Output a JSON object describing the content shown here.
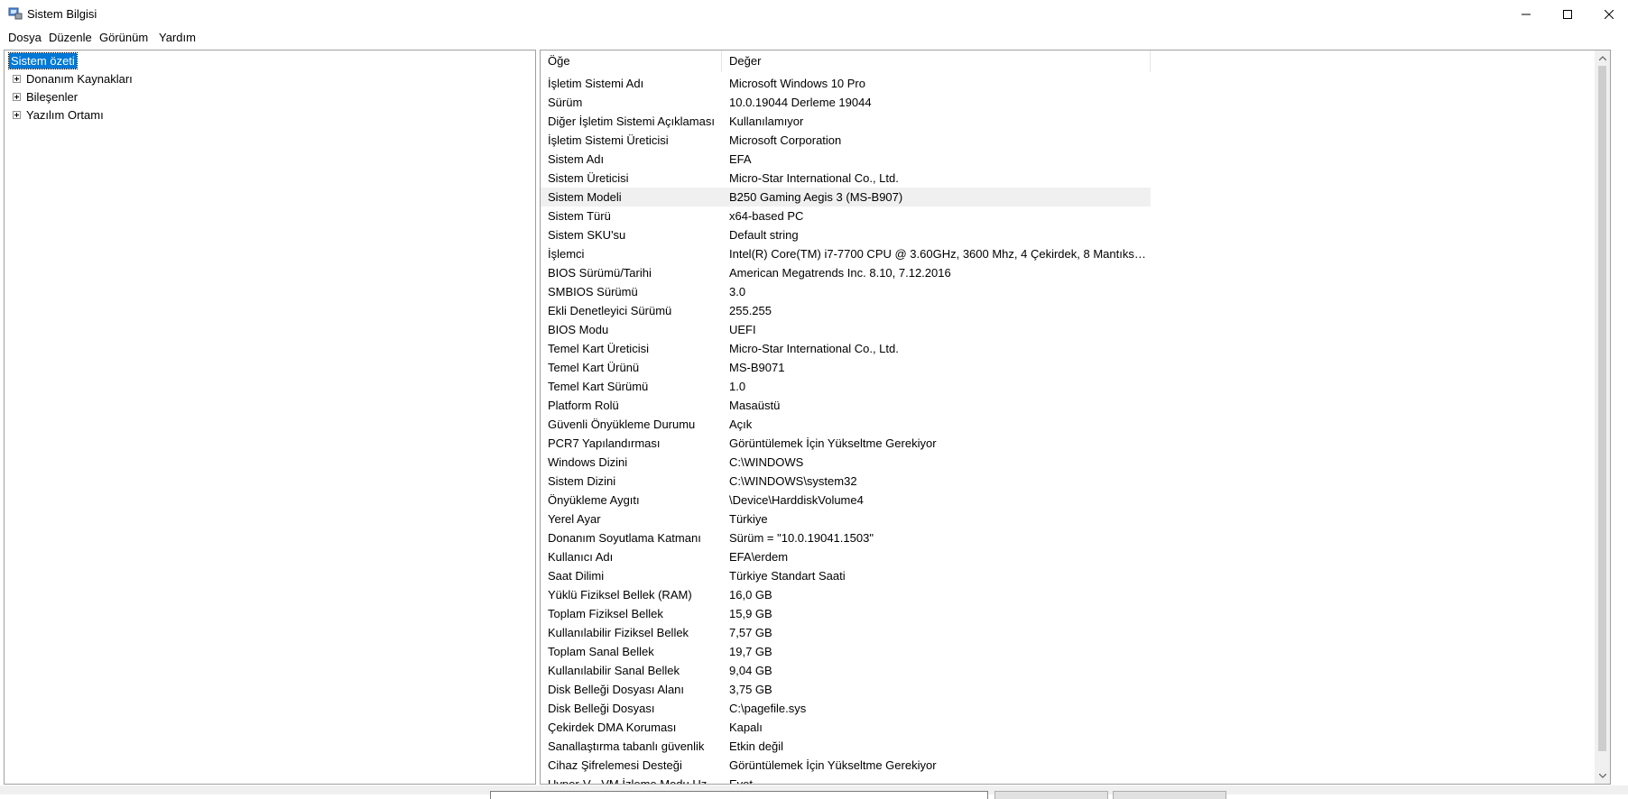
{
  "window": {
    "title": "Sistem Bilgisi",
    "controls": {
      "minimize": "minimize-icon",
      "maximize": "maximize-icon",
      "close": "close-icon"
    }
  },
  "menu": [
    "Dosya",
    "Düzenle",
    "Görünüm",
    "Yardım"
  ],
  "tree": {
    "selected": "Sistem özeti",
    "children": [
      "Donanım Kaynakları",
      "Bileşenler",
      "Yazılım Ortamı"
    ]
  },
  "table": {
    "headers": [
      "Öğe",
      "Değer"
    ],
    "highlight_row": 6,
    "rows": [
      [
        "İşletim Sistemi Adı",
        "Microsoft Windows 10 Pro"
      ],
      [
        "Sürüm",
        "10.0.19044 Derleme 19044"
      ],
      [
        "Diğer İşletim Sistemi Açıklaması",
        "Kullanılamıyor"
      ],
      [
        "İşletim Sistemi Üreticisi",
        "Microsoft Corporation"
      ],
      [
        "Sistem Adı",
        "EFA"
      ],
      [
        "Sistem Üreticisi",
        "Micro-Star International Co., Ltd."
      ],
      [
        "Sistem Modeli",
        "B250 Gaming Aegis 3 (MS-B907)"
      ],
      [
        "Sistem Türü",
        "x64-based PC"
      ],
      [
        "Sistem SKU'su",
        "Default string"
      ],
      [
        "İşlemci",
        "Intel(R) Core(TM) i7-7700 CPU @ 3.60GHz, 3600 Mhz, 4 Çekirdek, 8 Mantıksal İ..."
      ],
      [
        "BIOS Sürümü/Tarihi",
        "American Megatrends Inc. 8.10, 7.12.2016"
      ],
      [
        "SMBIOS Sürümü",
        "3.0"
      ],
      [
        "Ekli Denetleyici Sürümü",
        "255.255"
      ],
      [
        "BIOS Modu",
        "UEFI"
      ],
      [
        "Temel Kart Üreticisi",
        "Micro-Star International Co., Ltd."
      ],
      [
        "Temel Kart Ürünü",
        "MS-B9071"
      ],
      [
        "Temel Kart Sürümü",
        "1.0"
      ],
      [
        "Platform Rolü",
        "Masaüstü"
      ],
      [
        "Güvenli Önyükleme Durumu",
        "Açık"
      ],
      [
        "PCR7 Yapılandırması",
        "Görüntülemek İçin Yükseltme Gerekiyor"
      ],
      [
        "Windows Dizini",
        "C:\\WINDOWS"
      ],
      [
        "Sistem Dizini",
        "C:\\WINDOWS\\system32"
      ],
      [
        "Önyükleme Aygıtı",
        "\\Device\\HarddiskVolume4"
      ],
      [
        "Yerel Ayar",
        "Türkiye"
      ],
      [
        "Donanım Soyutlama Katmanı",
        "Sürüm = \"10.0.19041.1503\""
      ],
      [
        "Kullanıcı Adı",
        "EFA\\erdem"
      ],
      [
        "Saat Dilimi",
        "Türkiye Standart Saati"
      ],
      [
        "Yüklü Fiziksel Bellek (RAM)",
        "16,0 GB"
      ],
      [
        "Toplam Fiziksel Bellek",
        "15,9 GB"
      ],
      [
        "Kullanılabilir Fiziksel Bellek",
        "7,57 GB"
      ],
      [
        "Toplam Sanal Bellek",
        "19,7 GB"
      ],
      [
        "Kullanılabilir Sanal Bellek",
        "9,04 GB"
      ],
      [
        "Disk Belleği Dosyası Alanı",
        "3,75 GB"
      ],
      [
        "Disk Belleği Dosyası",
        "C:\\pagefile.sys"
      ],
      [
        "Çekirdek DMA Koruması",
        "Kapalı"
      ],
      [
        "Sanallaştırma tabanlı güvenlik",
        "Etkin değil"
      ],
      [
        "Cihaz Şifrelemesi Desteği",
        "Görüntülemek İçin Yükseltme Gerekiyor"
      ],
      [
        "Hyper-V - VM İzleme Modu Uz...",
        "Evet"
      ]
    ]
  }
}
